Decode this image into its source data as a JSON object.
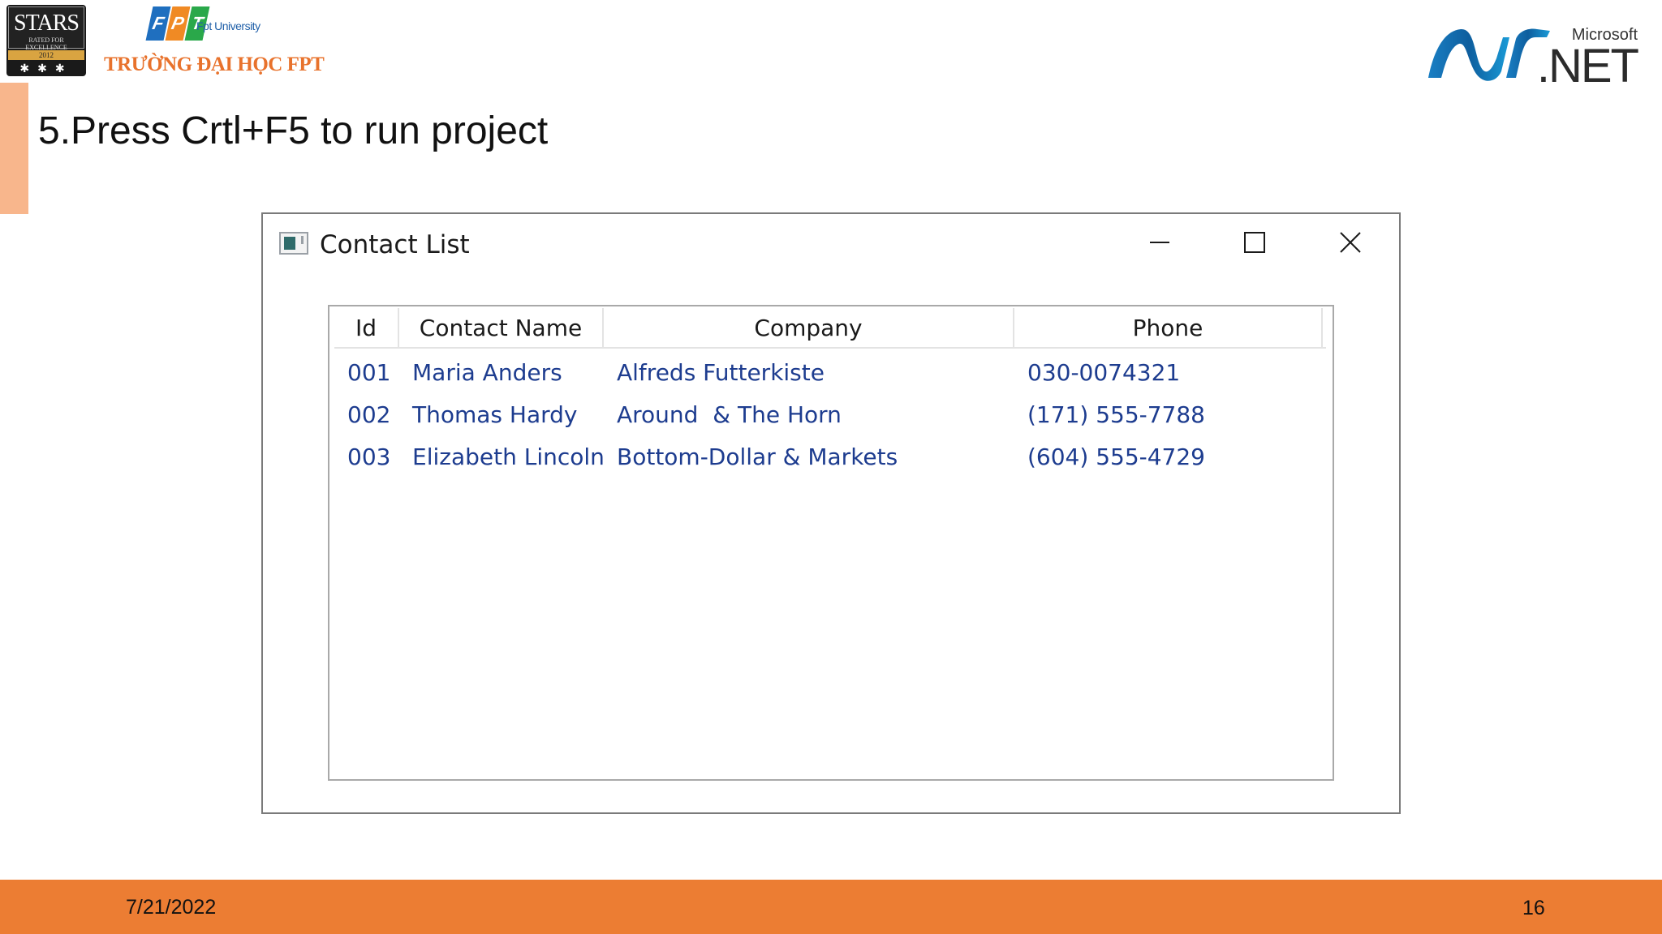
{
  "logos": {
    "stars": {
      "word": "STARS",
      "subtitle": "RATED FOR EXCELLENCE",
      "year": "2012"
    },
    "fpt": {
      "tile_letters": [
        "F",
        "P",
        "T"
      ],
      "university": "Fpt University",
      "name_vn": "TRƯỜNG ĐẠI HỌC FPT"
    },
    "dotnet": {
      "vendor": "Microsoft",
      "product": ".NET"
    }
  },
  "slide": {
    "title": "5.Press Crtl+F5 to run project",
    "date": "7/21/2022",
    "page_number": "16"
  },
  "window": {
    "title": "Contact List",
    "controls": {
      "minimize": "minimize",
      "maximize": "maximize",
      "close": "close"
    }
  },
  "listview": {
    "columns": [
      "Id",
      "Contact Name",
      "Company",
      "Phone"
    ],
    "rows": [
      {
        "id": "001",
        "name": "Maria Anders",
        "company": "Alfreds Futterkiste",
        "phone": "030-0074321"
      },
      {
        "id": "002",
        "name": "Thomas Hardy",
        "company": "Around  & The Horn",
        "phone": "(171) 555-7788"
      },
      {
        "id": "003",
        "name": "Elizabeth Lincoln",
        "company": "Bottom-Dollar & Markets",
        "phone": "(604) 555-4729"
      }
    ]
  },
  "colors": {
    "accent_orange": "#ec7d33",
    "accent_light": "#f8b68c",
    "row_text": "#1d3c8f"
  }
}
